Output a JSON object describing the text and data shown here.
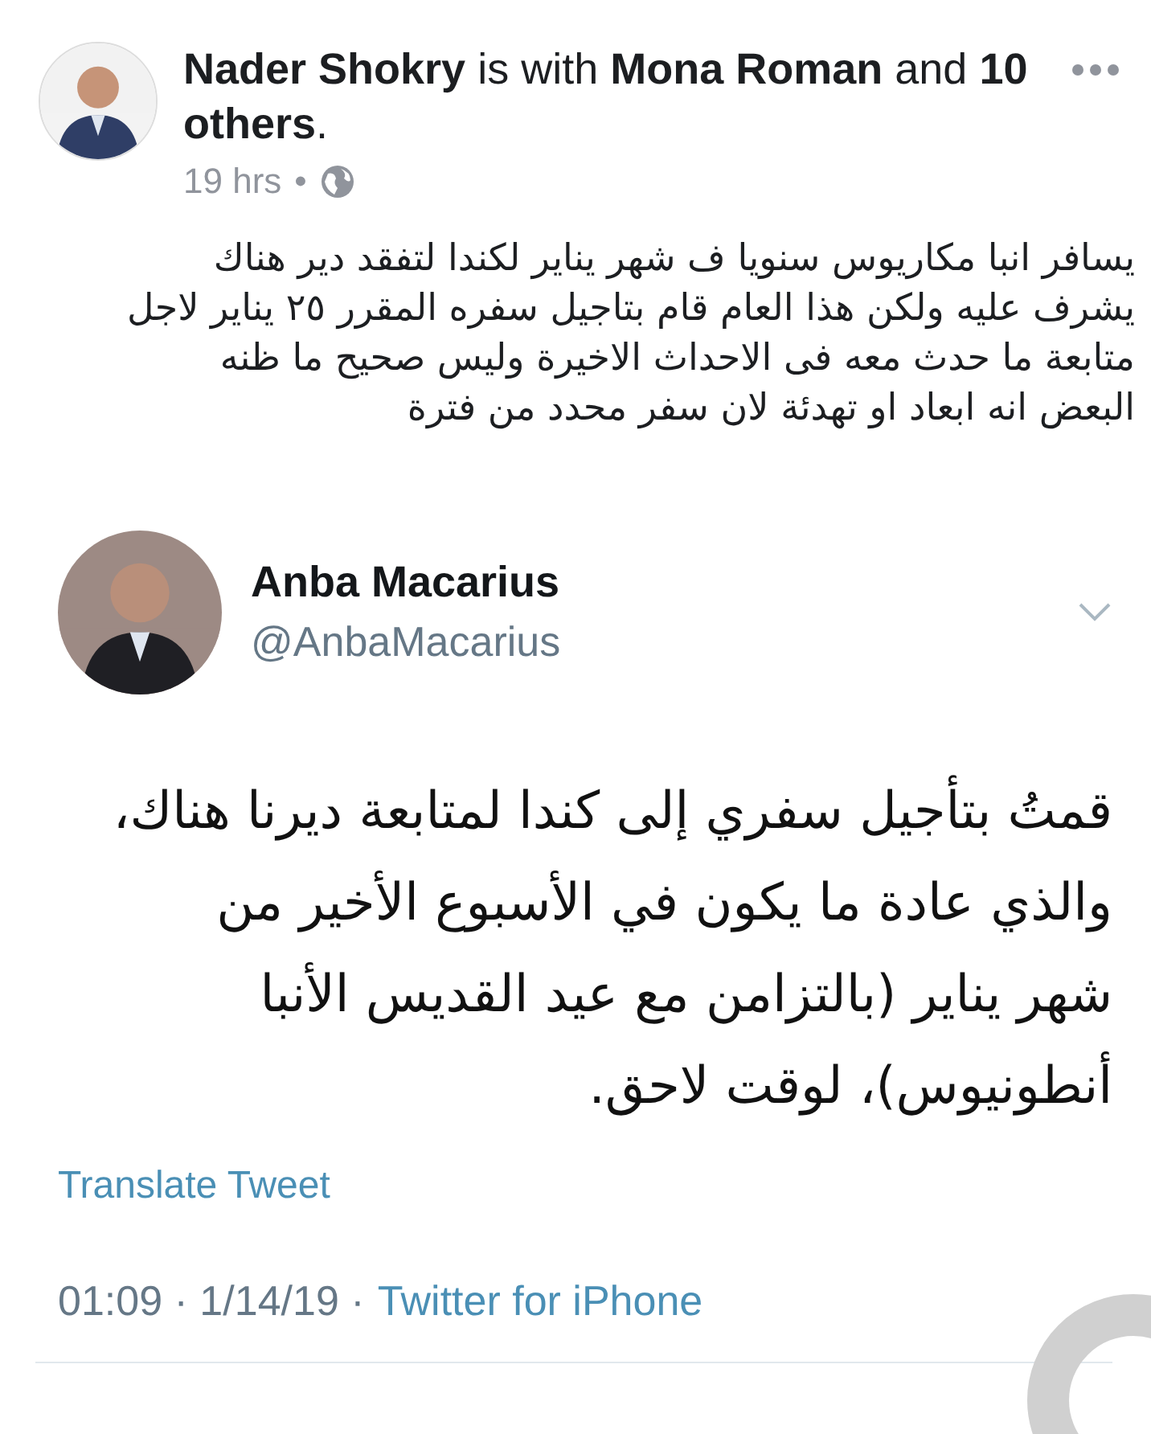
{
  "post": {
    "header": "**Nader Shokry** is with **Mona Roman** and **10 others**.",
    "time": "19 hrs",
    "separator": "•",
    "body_lines": [
      "يسافر انبا مكاريوس سنويا ف شهر يناير لكندا لتفقد دير هناك",
      "يشرف عليه ولكن هذا العام قام بتاجيل سفره المقرر ٢٥ يناير لاجل",
      "متابعة ما حدث معه فى الاحداث الاخيرة وليس صحيح ما ظنه",
      "البعض انه ابعاد او تهدئة لان سفر محدد من فترة"
    ]
  },
  "tweet": {
    "name": "Anba Macarius",
    "handle": "@AnbaMacarius",
    "text_lines": [
      "قمتُ بتأجيل سفري إلى كندا لمتابعة ديرنا هناك،",
      "والذي عادة ما يكون في الأسبوع الأخير من",
      "شهر يناير (بالتزامن مع عيد القديس الأنبا",
      "أنطونيوس)، لوقت لاحق."
    ],
    "translate": "Translate Tweet",
    "time": "01:09 · 1/14/19 ·",
    "source": "Twitter for iPhone"
  }
}
